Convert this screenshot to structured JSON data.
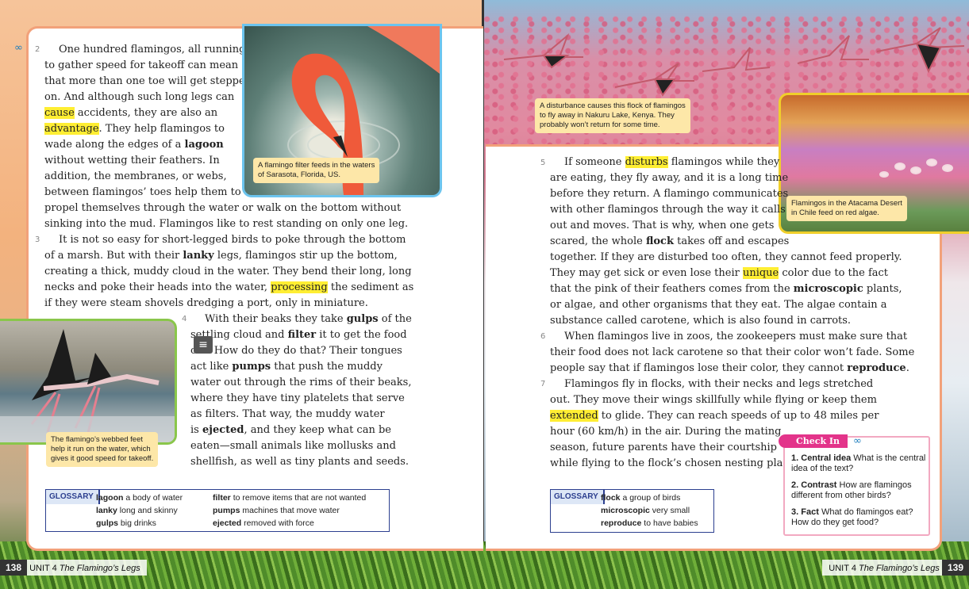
{
  "left_page": {
    "p2": {
      "num": "2",
      "lines": [
        "One hundred flamingos, all running",
        "to gather speed for takeoff can mean",
        "that more than one toe will get stepped",
        "on. And although such long legs can"
      ],
      "l5_hl": "cause",
      "l5_rest": " accidents, they are also an",
      "l6_hl": "advantage",
      "l6_rest": ". They help flamingos to",
      "l7_pre": "wade along the edges of a ",
      "l7_b": "lagoon",
      "l8": "without wetting their feathers. In",
      "l9": "addition, the membranes, or webs,",
      "l10": "between flamingos’ toes help them to",
      "l11": "propel themselves through the water or walk on the bottom without",
      "l12": "sinking into the mud. Flamingos like to rest standing on only one leg."
    },
    "p3": {
      "num": "3",
      "l1": "It is not so easy for short-legged birds to poke through the bottom",
      "l2_pre": "of a marsh. But with their ",
      "l2_b": "lanky",
      "l2_rest": " legs, flamingos stir up the bottom,",
      "l3": "creating a thick, muddy cloud in the water. They bend their long, long",
      "l4_pre": "necks and poke their heads into the water, ",
      "l4_hl": "processing",
      "l4_rest": " the sediment as",
      "l5": "if they were steam shovels dredging a port, only in miniature."
    },
    "p4": {
      "num": "4",
      "l1_pre": "With their beaks they take ",
      "l1_b": "gulps",
      "l1_rest": " of the",
      "l2_pre": "settling cloud and ",
      "l2_b": "filter",
      "l2_rest": " it to get the food",
      "l3": "out. How do they do that? Their tongues",
      "l4_pre": "act like ",
      "l4_b": "pumps",
      "l4_rest": " that push the muddy",
      "l5": "water out through the rims of their beaks,",
      "l6": "where they have tiny platelets that serve",
      "l7": "as filters. That way, the muddy water",
      "l8_pre": "is ",
      "l8_b": "ejected",
      "l8_rest": ", and they keep what can be",
      "l9": "eaten—small animals like mollusks and",
      "l10": "shellfish, as well as tiny plants and seeds."
    },
    "caption_filter": [
      "A flamingo filter feeds in the waters",
      "of Sarasota, Florida, US."
    ],
    "caption_run": [
      "The flamingo’s webbed feet",
      "help it run on the water, which",
      "gives it good speed for takeoff."
    ],
    "glossary": {
      "tag": "GLOSSARY",
      "col1": [
        {
          "term": "lagoon",
          "def": "a body of water"
        },
        {
          "term": "lanky",
          "def": "long and skinny"
        },
        {
          "term": "gulps",
          "def": "big drinks"
        }
      ],
      "col2": [
        {
          "term": "filter",
          "def": "to remove items that are not wanted"
        },
        {
          "term": "pumps",
          "def": "machines that move water"
        },
        {
          "term": "ejected",
          "def": "removed with force"
        }
      ]
    },
    "footer": {
      "page": "138",
      "unit": "UNIT 4",
      "title": "The Flamingo’s Legs"
    }
  },
  "right_page": {
    "caption_disturb": [
      "A disturbance causes this flock of flamingos",
      "to fly away in Nakuru Lake, Kenya. They",
      "probably won’t return for some time."
    ],
    "caption_atacama": [
      "Flamingos in the Atacama Desert",
      "in Chile feed on red algae."
    ],
    "p5": {
      "num": "5",
      "l1_pre": "If someone ",
      "l1_hl": "disturbs",
      "l1_rest": " flamingos while they",
      "l2": "are eating, they fly away, and it is a long time",
      "l3": "before they return. A flamingo communicates",
      "l4": "with other flamingos through the way it calls",
      "l5": "out and moves. That is why, when one gets",
      "l6_pre": "scared, the whole ",
      "l6_b": "flock",
      "l6_rest": " takes off and escapes",
      "l7": "together. If they are disturbed too often, they cannot feed properly.",
      "l8_pre": "They may get sick or even lose their ",
      "l8_hl": "unique",
      "l8_rest": " color due to the fact",
      "l9_pre": "that the pink of their feathers comes from the ",
      "l9_b": "microscopic",
      "l9_rest": " plants,",
      "l10": "or algae, and other organisms that they eat. The algae contain a",
      "l11": "substance called carotene, which is also found in carrots."
    },
    "p6": {
      "num": "6",
      "l1": "When flamingos live in zoos, the zookeepers must make sure that",
      "l2": "their food does not lack carotene so that their color won’t fade. Some",
      "l3_pre": "people say that if flamingos lose their color, they cannot ",
      "l3_b": "reproduce",
      "l3_rest": "."
    },
    "p7": {
      "num": "7",
      "l1": "Flamingos fly in flocks, with their necks and legs stretched",
      "l2": "out. They move their wings skillfully while flying or keep them",
      "l3_hl": "extended",
      "l3_rest": " to glide. They can reach speeds of up to 48 miles per",
      "l4": "hour (60 km/h) in the air. During the mating",
      "l5": "season, future parents have their courtship",
      "l6": "while flying to the flock’s chosen nesting place."
    },
    "glossary": {
      "tag": "GLOSSARY",
      "items": [
        {
          "term": "flock",
          "def": "a group of birds"
        },
        {
          "term": "microscopic",
          "def": "very small"
        },
        {
          "term": "reproduce",
          "def": "to have babies"
        }
      ]
    },
    "checkin": {
      "title": "Check In",
      "items": [
        {
          "num": "1.",
          "label": "Central idea",
          "text": "What is the central idea of the text?"
        },
        {
          "num": "2.",
          "label": "Contrast",
          "text": "How are flamingos different from other birds?"
        },
        {
          "num": "3.",
          "label": "Fact",
          "text": "What do flamingos eat? How do they get food?"
        }
      ]
    },
    "footer": {
      "page": "139",
      "unit": "UNIT 4",
      "title": "The Flamingo’s Legs"
    }
  },
  "icons": {
    "link": "∞",
    "note": "≡"
  }
}
